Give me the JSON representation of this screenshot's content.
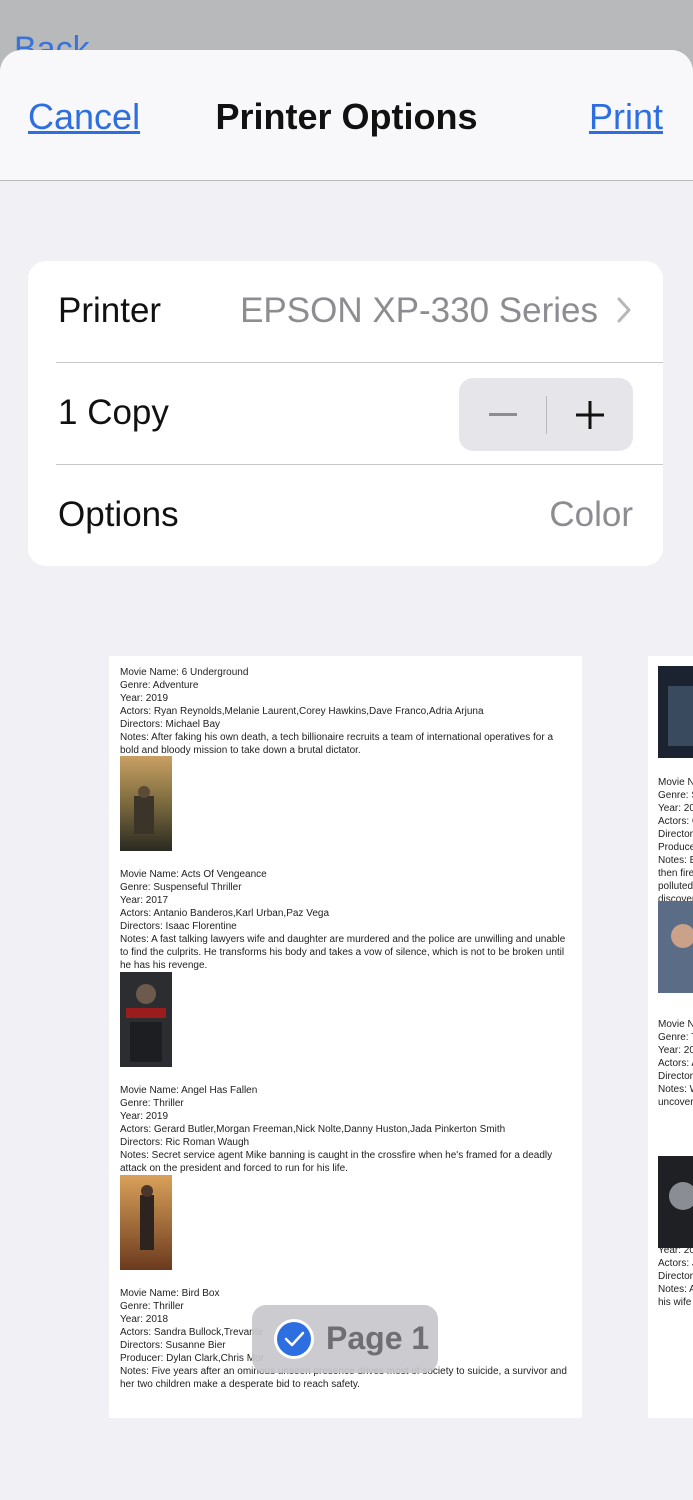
{
  "behind": {
    "back_label": "Back"
  },
  "navbar": {
    "cancel_label": "Cancel",
    "title": "Printer Options",
    "print_label": "Print"
  },
  "settings": {
    "printer_label": "Printer",
    "printer_value": "EPSON XP-330 Series",
    "copies_label": "1 Copy",
    "options_label": "Options",
    "options_value": "Color"
  },
  "preview": {
    "movies": [
      {
        "name": "Movie Name: 6 Underground",
        "genre": "Genre: Adventure",
        "year": "Year: 2019",
        "actors": "Actors: Ryan Reynolds,Melanie Laurent,Corey Hawkins,Dave Franco,Adria Arjuna",
        "directors": "Directors: Michael Bay",
        "notes": "Notes: After faking his own death, a tech billionaire recruits a team of international operatives for a bold and bloody mission to take down a brutal dictator."
      },
      {
        "name": "Movie Name: Acts Of Vengeance",
        "genre": "Genre: Suspenseful Thriller",
        "year": "Year: 2017",
        "actors": "Actors: Antanio Banderos,Karl Urban,Paz Vega",
        "directors": "Directors: Isaac Florentine",
        "notes": "Notes: A fast talking lawyers wife and daughter are murdered and the police are unwilling and unable to find the culprits.  He transforms his body and takes a vow of silence, which is not to be broken until he has his revenge."
      },
      {
        "name": "Movie Name: Angel Has Fallen",
        "genre": "Genre: Thriller",
        "year": "Year: 2019",
        "actors": "Actors: Gerard Butler,Morgan Freeman,Nick Nolte,Danny Huston,Jada Pinkerton Smith",
        "directors": "Directors: Ric Roman Waugh",
        "notes": "Notes: Secret service agent Mike banning is caught in the crossfire when he's framed for a deadly attack on the president and forced to run for his life."
      },
      {
        "name": "Movie Name: Bird Box",
        "genre": "Genre: Thriller",
        "year": "Year: 2018",
        "actors": "Actors: Sandra Bullock,Trevante",
        "directors": "Directors: Susanne Bier",
        "producer": "Producer: Dylan Clark,Chris Mor",
        "notes": "Notes: Five years after an ominous unseen presence drives most of society to suicide, a survivor and her two children make a desperate bid to reach safety."
      }
    ],
    "next_page_snippets": [
      "Movie N",
      "Genre: S",
      "Year: 20",
      "Actors: C",
      "Directors",
      "Produce",
      "Notes: B",
      "then fire",
      "polluted,",
      "discover",
      "Movie N",
      "Genre: T",
      "Year: 20",
      "Actors: A",
      "Directors",
      "Notes: W",
      "uncovers",
      "Movie N",
      "Genre: V",
      "Year: 20",
      "Actors: J",
      "Directors",
      "Notes: A",
      "his wife"
    ],
    "page_badge": "Page 1"
  },
  "colors": {
    "accent": "#2d6ee0",
    "badge_check": "#2d6ee0",
    "sheet_bg": "#f1f1f5"
  }
}
